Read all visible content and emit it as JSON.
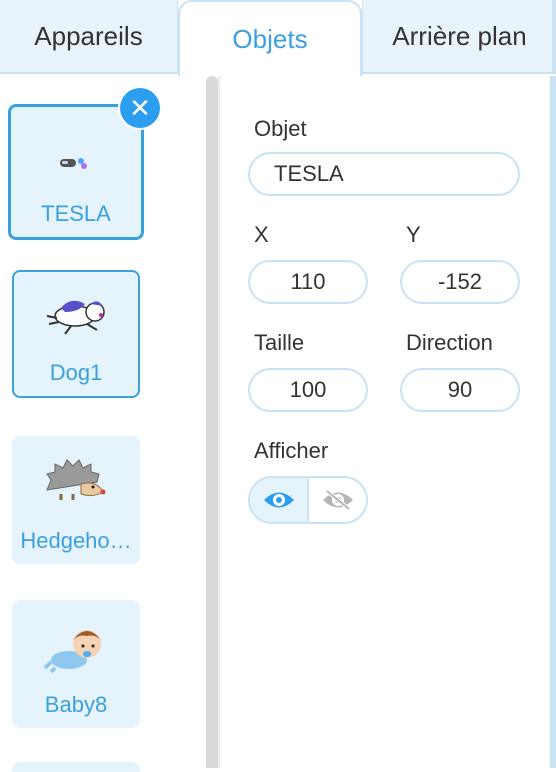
{
  "tabs": [
    {
      "label": "Appareils"
    },
    {
      "label": "Objets",
      "active": true
    },
    {
      "label": "Arrière plan"
    }
  ],
  "sprites": [
    {
      "name": "TESLA",
      "selected": true,
      "icon": "car-icon"
    },
    {
      "name": "Dog1",
      "icon": "dog-icon"
    },
    {
      "name": "Hedgeho…",
      "icon": "hedgehog-icon"
    },
    {
      "name": "Baby8",
      "icon": "baby-icon"
    }
  ],
  "properties": {
    "object_label": "Objet",
    "object_value": "TESLA",
    "x_label": "X",
    "x_value": "110",
    "y_label": "Y",
    "y_value": "-152",
    "size_label": "Taille",
    "size_value": "100",
    "direction_label": "Direction",
    "direction_value": "90",
    "show_label": "Afficher",
    "visible": true
  },
  "colors": {
    "accent": "#3aa0e0",
    "card_bg": "#e5f3fd",
    "border": "#c9e3f4"
  }
}
